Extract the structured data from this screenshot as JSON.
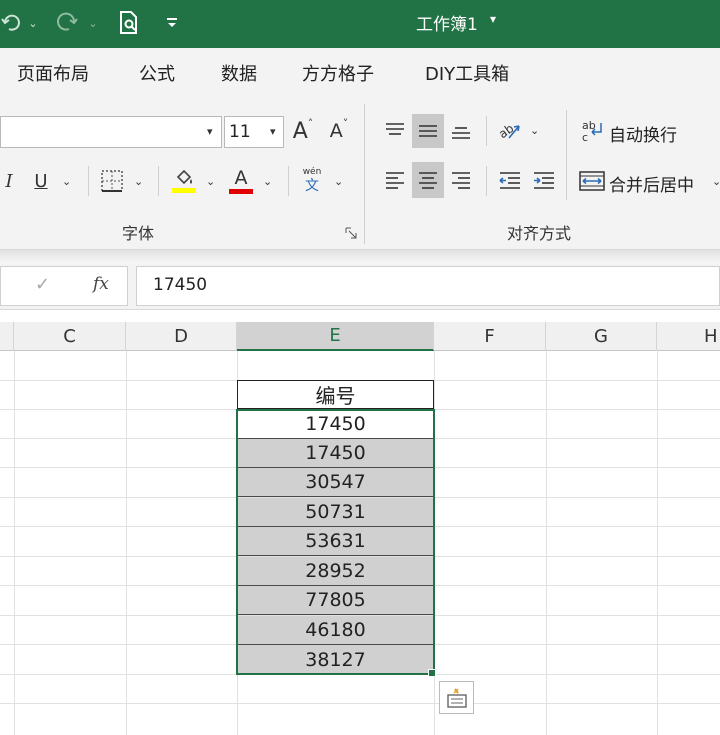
{
  "titlebar": {
    "title": "工作簿1",
    "title_caret": "▾",
    "undo_icon": "undo-icon",
    "redo_icon": "redo-icon",
    "print_preview_icon": "print-preview-icon",
    "customize_icon": "customize-quick-access-icon",
    "colors": {
      "background": "#217346",
      "text": "#ffffff"
    }
  },
  "ribbon": {
    "tabs": [
      {
        "label": "页面布局"
      },
      {
        "label": "公式"
      },
      {
        "label": "数据"
      },
      {
        "label": "方方格子"
      },
      {
        "label": "DIY工具箱"
      }
    ],
    "font": {
      "font_name": "",
      "font_size": "11",
      "increase_font_glyph": "A",
      "decrease_font_glyph": "A",
      "italic_glyph": "I",
      "underline_glyph": "U",
      "font_color_glyph": "A",
      "phonetic_glyph_top": "wén",
      "phonetic_glyph_bottom": "文",
      "group_label": "字体",
      "highlight_color": "#ffff00",
      "font_color": "#e00000"
    },
    "alignment": {
      "wrap_text_label": "自动换行",
      "merge_center_label": "合并后居中",
      "group_label": "对齐方式"
    }
  },
  "formula_bar": {
    "confirm_glyph": "✓",
    "fx_glyph": "fx",
    "value": "17450"
  },
  "grid": {
    "columns": [
      "C",
      "D",
      "E",
      "F",
      "G",
      "H"
    ],
    "selected_column": "E",
    "header_cell": "编号",
    "values": [
      "17450",
      "17450",
      "30547",
      "50731",
      "53631",
      "28952",
      "77805",
      "46180",
      "38127"
    ],
    "selection_color": "#217346",
    "highlight_fill": "#d0d0d0"
  }
}
